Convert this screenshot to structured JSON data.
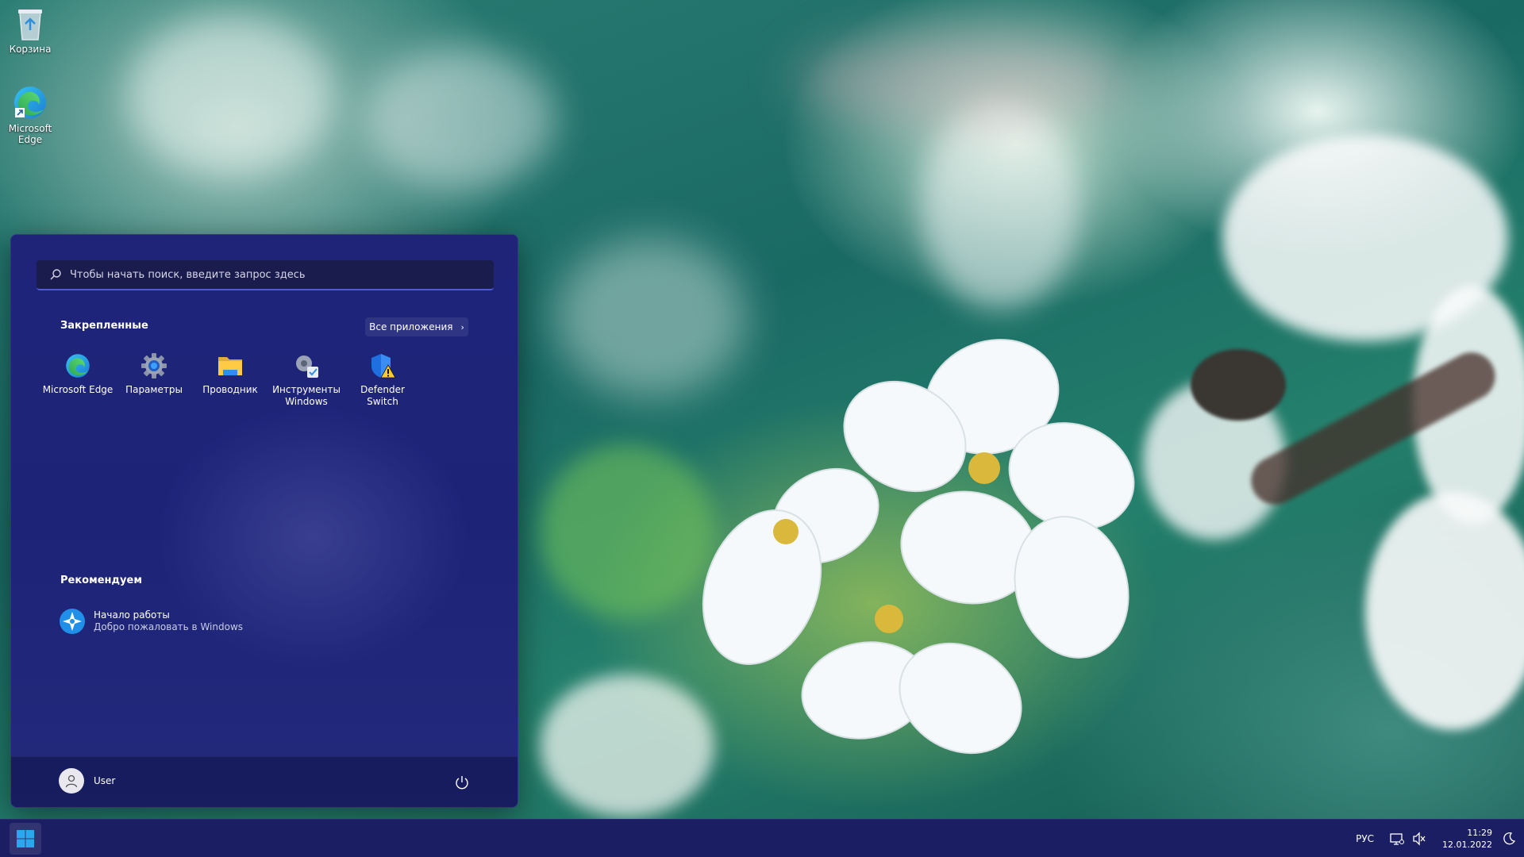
{
  "desktop": {
    "icons": [
      {
        "label": "Корзина"
      },
      {
        "label": "Microsoft Edge"
      }
    ]
  },
  "start_menu": {
    "search": {
      "placeholder": "Чтобы начать поиск, введите запрос здесь"
    },
    "pinned": {
      "title": "Закрепленные",
      "all_apps_label": "Все приложения",
      "apps": [
        {
          "label": "Microsoft Edge",
          "icon": "edge-icon"
        },
        {
          "label": "Параметры",
          "icon": "gear-icon"
        },
        {
          "label": "Проводник",
          "icon": "folder-icon"
        },
        {
          "label": "Инструменты Windows",
          "icon": "tools-icon"
        },
        {
          "label": "Defender Switch",
          "icon": "shield-warning-icon"
        }
      ]
    },
    "recommended": {
      "title": "Рекомендуем",
      "items": [
        {
          "title": "Начало работы",
          "subtitle": "Добро пожаловать в Windows",
          "icon": "get-started-icon"
        }
      ]
    },
    "footer": {
      "user_name": "User"
    }
  },
  "taskbar": {
    "language": "РУС",
    "time": "11:29",
    "date": "12.01.2022"
  },
  "colors": {
    "start_menu_bg": "#1f2479",
    "taskbar_bg": "#1b1e62",
    "search_underline": "#4c5bd8",
    "windows_blue": "#29a8f0"
  }
}
